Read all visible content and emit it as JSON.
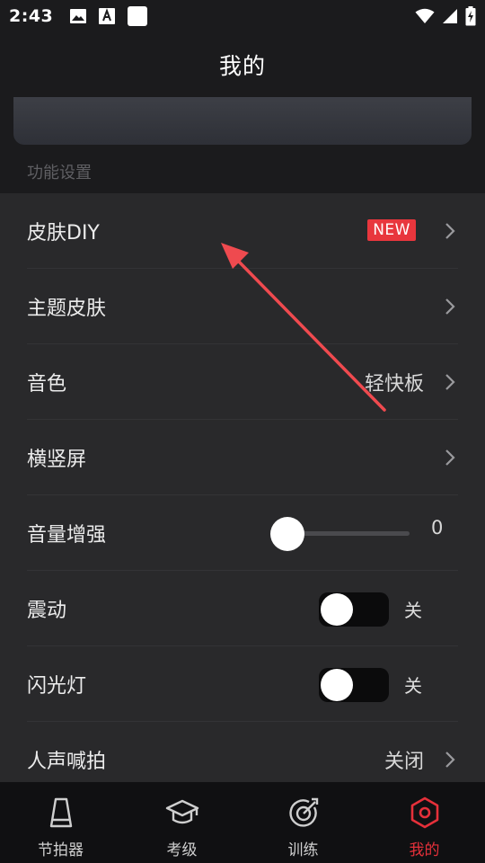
{
  "status": {
    "time": "2:43"
  },
  "header": {
    "title": "我的"
  },
  "section": {
    "label": "功能设置"
  },
  "settings": {
    "skin_diy": {
      "label": "皮肤DIY",
      "badge": "NEW"
    },
    "theme_skin": {
      "label": "主题皮肤"
    },
    "tone": {
      "label": "音色",
      "value": "轻快板"
    },
    "orientation": {
      "label": "横竖屏"
    },
    "volume_boost": {
      "label": "音量增强",
      "value": "0",
      "level": 0
    },
    "vibration": {
      "label": "震动",
      "state": "关",
      "enabled": false
    },
    "flashlight": {
      "label": "闪光灯",
      "state": "关",
      "enabled": false
    },
    "voice_beat": {
      "label": "人声喊拍",
      "value": "关闭"
    }
  },
  "tabs": [
    {
      "label": "节拍器",
      "icon": "metronome-icon",
      "active": false
    },
    {
      "label": "考级",
      "icon": "graduation-cap-icon",
      "active": false
    },
    {
      "label": "训练",
      "icon": "target-icon",
      "active": false
    },
    {
      "label": "我的",
      "icon": "hexagon-profile-icon",
      "active": true
    }
  ],
  "colors": {
    "background": "#1b1b1d",
    "list_background": "#29292b",
    "accent": "#e5303a",
    "badge": "#e8363d",
    "annotation_arrow": "#ef4a4f"
  }
}
